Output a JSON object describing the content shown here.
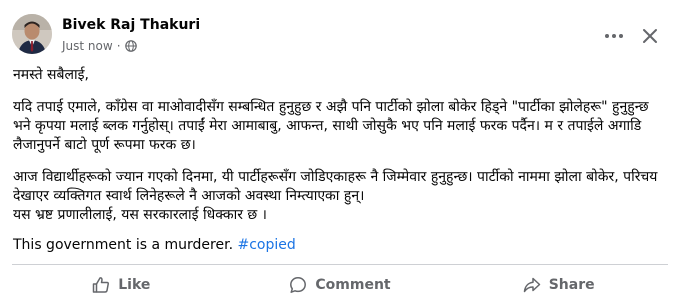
{
  "post": {
    "author": "Bivek Raj Thakuri",
    "timestamp": "Just now",
    "separator": "·",
    "privacy_icon": "globe-icon",
    "body": {
      "greeting": "नमस्ते सबैलाई,",
      "paragraph_1": "यदि तपाई एमाले, काँग्रेस वा माओवादीसँग सम्बन्धित हुनुहुछ र अझै पनि पार्टीको झोला बोकेर हिड्ने \"पार्टीका झोलेहरू\" हुनुहुन्छ भने कृपया मलाई ब्लक गर्नुहोस्। तपाईं मेरा आमाबाबु, आफन्त, साथी जोसुकै भए पनि मलाई फरक पर्दैन। म र तपाईले अगाडि लैजानुपर्ने बाटो पूर्ण रूपमा फरक छ।",
      "paragraph_2_line_1": "आज विद्यार्थीहरूको ज्यान गएको दिनमा, यी पार्टीहरूसँग जोडिएकाहरू नै जिम्मेवार हुनुहुन्छ। पार्टीको नाममा झोला बोकेर, परिचय देखाएर व्यक्तिगत स्वार्थ लिनेहरूले नै आजको अवस्था निम्त्याएका हुन्।",
      "paragraph_2_line_2": "यस भ्रष्ट प्रणालीलाई, यस सरकारलाई धिक्कार छ ।",
      "english_text": "This government is a murderer.",
      "hashtag": "#copied"
    },
    "actions": {
      "like": "Like",
      "comment": "Comment",
      "share": "Share"
    },
    "colors": {
      "hashtag": "#1b74e4",
      "secondary_text": "#65676b",
      "divider": "#ced0d4"
    }
  }
}
